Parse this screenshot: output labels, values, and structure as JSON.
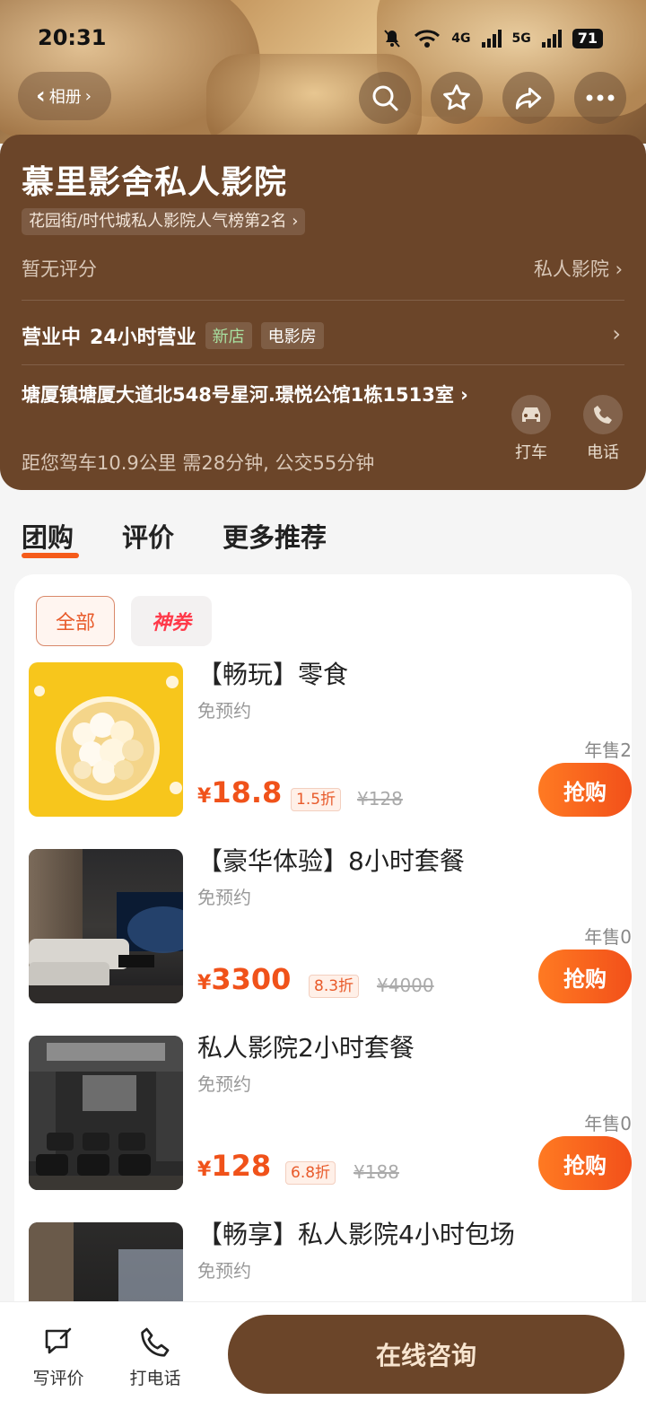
{
  "status_bar": {
    "time": "20:31",
    "network1": "4G",
    "network2": "5G",
    "battery": "71"
  },
  "header": {
    "album_label": "相册",
    "album_chevron": "›",
    "icons": [
      "search-icon",
      "star-icon",
      "share-icon",
      "more-icon"
    ]
  },
  "shop": {
    "name": "慕里影舍私人影院",
    "rank_tag": "花园街/时代城私人影院人气榜第2名 ›",
    "rating": "暂无评分",
    "category": "私人影院 ›",
    "status": "营业中",
    "hours": "24小时营业",
    "tag_new": "新店",
    "tag_type": "电影房",
    "address": "塘厦镇塘厦大道北548号星河.璟悦公馆1栋1513室 ›",
    "distance": "距您驾车10.9公里 需28分钟, 公交55分钟",
    "actions": {
      "taxi": "打车",
      "phone": "电话"
    }
  },
  "tabs": [
    "团购",
    "评价",
    "更多推荐"
  ],
  "filters": {
    "all": "全部",
    "coupon": "神券"
  },
  "deals": [
    {
      "title": "【畅玩】零食",
      "subtitle": "免预约",
      "sold": "年售2",
      "currency": "¥",
      "price": "18.8",
      "discount": "1.5折",
      "original": "¥128",
      "buy": "抢购"
    },
    {
      "title": "【豪华体验】8小时套餐",
      "subtitle": "免预约",
      "sold": "年售0",
      "currency": "¥",
      "price": "3300",
      "discount": "8.3折",
      "original": "¥4000",
      "buy": "抢购"
    },
    {
      "title": "私人影院2小时套餐",
      "subtitle": "免预约",
      "sold": "年售0",
      "currency": "¥",
      "price": "128",
      "discount": "6.8折",
      "original": "¥188",
      "buy": "抢购"
    },
    {
      "title": "【畅享】私人影院4小时包场",
      "subtitle": "免预约"
    }
  ],
  "bottom_bar": {
    "review": "写评价",
    "call": "打电话",
    "consult": "在线咨询"
  },
  "colors": {
    "brand_brown": "#6b4529",
    "accent_orange": "#f2501a"
  }
}
